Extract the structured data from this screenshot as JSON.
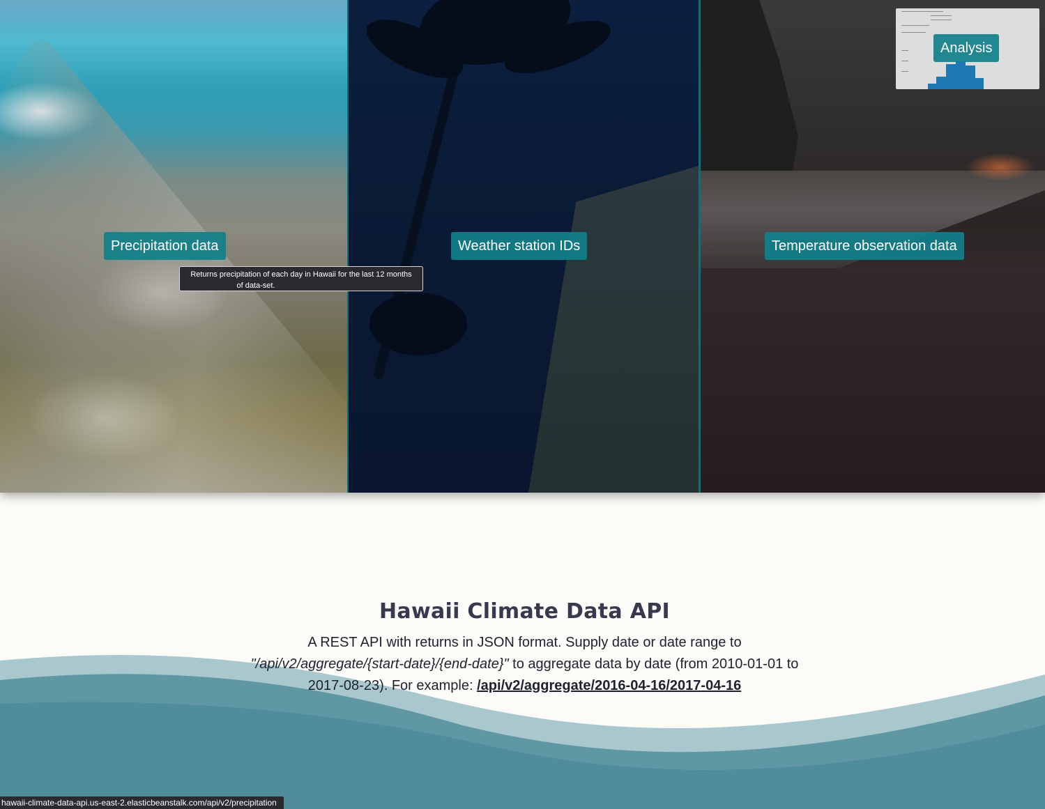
{
  "panels": [
    {
      "label": "Precipitation data"
    },
    {
      "label": "Weather station IDs"
    },
    {
      "label": "Temperature observation data"
    }
  ],
  "tooltip": {
    "line1": "Returns precipitation of each day in Hawaii for the last 12 months",
    "line2": "of data-set."
  },
  "analysis": {
    "label": "Analysis"
  },
  "intro": {
    "title": "Hawaii Climate Data API",
    "text_before": "A REST API with returns in JSON format. Supply date or date range to ",
    "endpoint_template": "\"/api/v2/aggregate/{start-date}/{end-date}\"",
    "text_middle": " to aggregate data by date (from 2010-01-01 to 2017-08-23). For example: ",
    "example_link": "/api/v2/aggregate/2016-04-16/2017-04-16"
  },
  "status_bar": {
    "url": "hawaii-climate-data-api.us-east-2.elasticbeanstalk.com/api/v2/precipitation"
  },
  "colors": {
    "button_bg": "#10808a",
    "divider": "#0d6f78",
    "page_bg": "#fcfbf7",
    "wave_light": "#a9c8ce",
    "wave_dark": "#4f8c9c",
    "title": "#373a4f"
  }
}
